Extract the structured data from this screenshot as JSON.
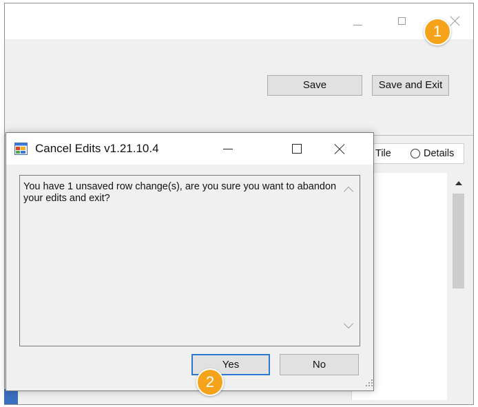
{
  "main_window": {
    "toolbar": {
      "save_label": "Save",
      "save_and_exit_label": "Save and Exit"
    },
    "view_options": {
      "tile_label": "Tile",
      "details_label": "Details"
    }
  },
  "dialog": {
    "title": "Cancel Edits v1.21.10.4",
    "message": "You have 1 unsaved row change(s), are you sure you want to abandon your edits and exit?",
    "yes_label": "Yes",
    "no_label": "No"
  },
  "callouts": {
    "step1": "1",
    "step2": "2"
  },
  "colors": {
    "callout": "#f5a31a",
    "focus_border": "#2b78d2",
    "window_bg": "#f0f0f0"
  }
}
